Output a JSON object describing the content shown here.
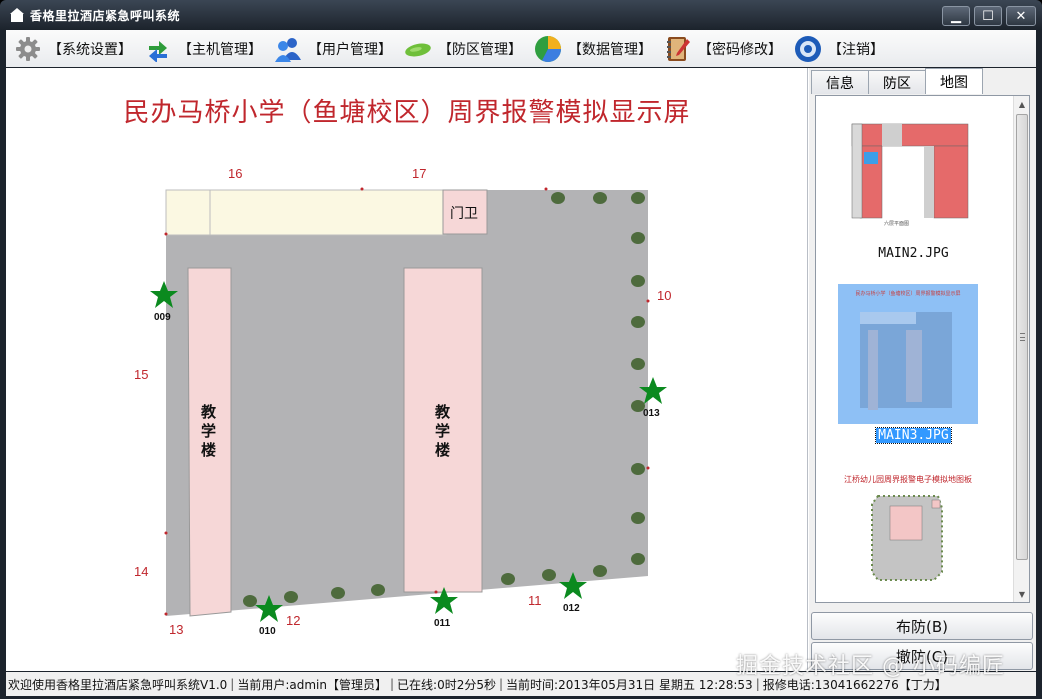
{
  "window": {
    "title": "香格里拉酒店紧急呼叫系统",
    "min_label": "▁",
    "max_label": "☐",
    "close_label": "✕"
  },
  "toolbar": {
    "items": [
      {
        "label": "【系统设置】",
        "icon": "gear-icon"
      },
      {
        "label": "【主机管理】",
        "icon": "sync-arrows-icon"
      },
      {
        "label": "【用户管理】",
        "icon": "users-icon"
      },
      {
        "label": "【防区管理】",
        "icon": "zone-icon"
      },
      {
        "label": "【数据管理】",
        "icon": "pie-chart-icon"
      },
      {
        "label": "【密码修改】",
        "icon": "notebook-pen-icon"
      },
      {
        "label": "【注销】",
        "icon": "logout-disc-icon"
      }
    ]
  },
  "map": {
    "title": "民办马桥小学（鱼塘校区）周界报警模拟显示屏",
    "building_label": "教学楼",
    "gate_label": "门卫",
    "zone_numbers": [
      "16",
      "17",
      "10",
      "15",
      "14",
      "13",
      "12",
      "11"
    ],
    "alarm_points": [
      "009",
      "010",
      "011",
      "012",
      "013"
    ]
  },
  "side": {
    "tabs": [
      "信息",
      "防区",
      "地图"
    ],
    "active_tab": "地图",
    "thumbnails": [
      {
        "caption": "MAIN2.JPG",
        "selected": false
      },
      {
        "caption": "MAIN3.JPG",
        "selected": true
      },
      {
        "caption": "",
        "selected": false
      }
    ],
    "thumb3_title": "江桥幼儿园周界报警电子模拟地图板",
    "thumb2_title": "民办马桥小学（鱼塘校区）周界报警模拟显示屏",
    "thumb1_caption_small": "六层平面图",
    "arm_button": "布防(B)",
    "disarm_button": "撤防(C)"
  },
  "status": {
    "welcome": "欢迎使用香格里拉酒店紧急呼叫系统V1.0",
    "user": "当前用户:admin【管理员】",
    "online": "已在线:0时2分5秒",
    "time": "当前时间:2013年05月31日 星期五 12:28:53",
    "phone": "报修电话:13041662276【丁力】"
  },
  "watermark": "掘金技术社区 @ 小码编匠",
  "colors": {
    "zone_red": "#c0272d",
    "star_green": "#0b8a1f",
    "selection_blue": "#3399ff",
    "ground_gray": "#b3b3b5",
    "building_pink": "#f6d7d7"
  }
}
